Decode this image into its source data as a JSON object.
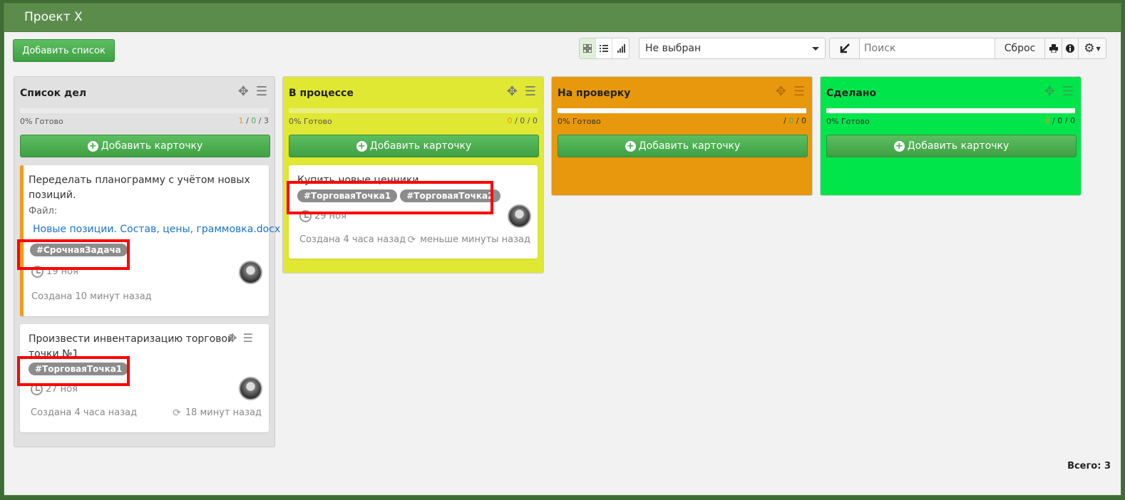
{
  "app": {
    "title": "Проект X",
    "total": "Всего: 3"
  },
  "toolbar": {
    "add_list_label": "Добавить список",
    "views": [
      "grid-icon",
      "list-icon",
      "chart-icon"
    ],
    "select_value": "Не выбран",
    "search_placeholder": "Поиск",
    "reset_label": "Сброс"
  },
  "columns": [
    {
      "title": "Список дел",
      "ready": "0% Готово",
      "c1": "1",
      "c2": "0",
      "c3": "3",
      "sep": "/",
      "add_label": "Добавить карточку",
      "cards": [
        {
          "title": "Переделать планограмму с учётом новых позиций.",
          "file_label": "Файл:",
          "file_name": "Новые позиции. Состав, цены, граммовка.docx",
          "tag": "#СрочнаяЗадача",
          "date": "19 ноя",
          "created": "Создана 10 минут назад"
        },
        {
          "title": "Произвести инвентаризацию торговой точки №1",
          "tag": "#ТорговаяТочка1",
          "date": "27 ноя",
          "created": "Создана 4 часа назад",
          "updated": "18 минут назад"
        }
      ]
    },
    {
      "title": "В процессе",
      "ready": "0% Готово",
      "c1": "0",
      "c2": "0",
      "c3": "0",
      "sep": "/",
      "add_label": "Добавить карточку",
      "cards": [
        {
          "title": "Купить новые ценники",
          "tag1": "#ТорговаяТочка1",
          "tag2": "#ТорговаяТочка2",
          "date": "29 ноя",
          "created": "Создана 4 часа назад",
          "updated": "меньше минуты назад"
        }
      ]
    },
    {
      "title": "На проверку",
      "ready": "0% Готово",
      "c1": "",
      "c2": "0",
      "c3": "0",
      "sep": "/",
      "add_label": "Добавить карточку"
    },
    {
      "title": "Сделано",
      "ready": "0% Готово",
      "c1": "0",
      "c2": "0",
      "c3": "0",
      "sep": "/",
      "add_label": "Добавить карточку"
    }
  ],
  "colors": {
    "header": "#5b8c4c",
    "col_todo": "#e1e1e1",
    "col_progress": "#e0e833",
    "col_review": "#e8980c",
    "col_done": "#00e64a",
    "highlight": "#ff0000",
    "tag": "#8c8c8c",
    "urgent_stripe": "#f39a1c"
  }
}
